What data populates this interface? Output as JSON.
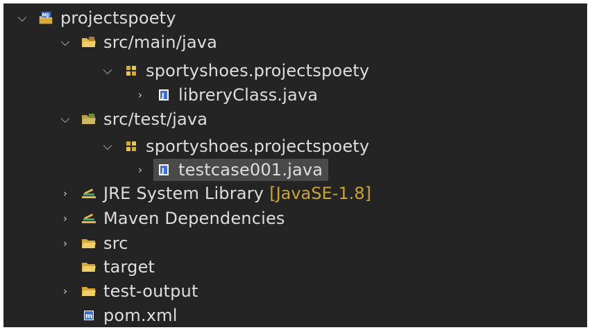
{
  "tree": {
    "items": [
      {
        "key": "project",
        "label": "projectspoety",
        "decoration": "",
        "expander": "expanded",
        "icon": "maven-project-icon",
        "selected": false
      },
      {
        "key": "src-main-java",
        "label": "src/main/java",
        "decoration": "",
        "expander": "expanded",
        "icon": "source-folder-icon",
        "selected": false
      },
      {
        "key": "pkg-main",
        "label": "sportyshoes.projectspoety",
        "decoration": "",
        "expander": "expanded",
        "icon": "package-icon",
        "selected": false
      },
      {
        "key": "librery-class",
        "label": "libreryClass.java",
        "decoration": "",
        "expander": "collapsed",
        "icon": "java-file-icon",
        "selected": false
      },
      {
        "key": "src-test-java",
        "label": "src/test/java",
        "decoration": "",
        "expander": "expanded",
        "icon": "test-source-folder-icon",
        "selected": false
      },
      {
        "key": "pkg-test",
        "label": "sportyshoes.projectspoety",
        "decoration": "",
        "expander": "expanded",
        "icon": "package-icon",
        "selected": false
      },
      {
        "key": "testcase001",
        "label": "testcase001.java",
        "decoration": "",
        "expander": "collapsed",
        "icon": "java-file-icon",
        "selected": true
      },
      {
        "key": "jre-library",
        "label": "JRE System Library",
        "decoration": "[JavaSE-1.8]",
        "expander": "collapsed",
        "icon": "library-icon",
        "selected": false
      },
      {
        "key": "maven-deps",
        "label": "Maven Dependencies",
        "decoration": "",
        "expander": "collapsed",
        "icon": "library-icon",
        "selected": false
      },
      {
        "key": "src",
        "label": "src",
        "decoration": "",
        "expander": "collapsed",
        "icon": "folder-icon",
        "selected": false
      },
      {
        "key": "target",
        "label": "target",
        "decoration": "",
        "expander": "none",
        "icon": "folder-icon",
        "selected": false
      },
      {
        "key": "test-output",
        "label": "test-output",
        "decoration": "",
        "expander": "collapsed",
        "icon": "folder-icon",
        "selected": false
      },
      {
        "key": "pom",
        "label": "pom.xml",
        "decoration": "",
        "expander": "none",
        "icon": "maven-pom-icon",
        "selected": false
      }
    ]
  },
  "colors": {
    "background": "#242424",
    "text": "#dedede",
    "decoration": "#c8a43a",
    "selection": "#4a4a4a"
  }
}
